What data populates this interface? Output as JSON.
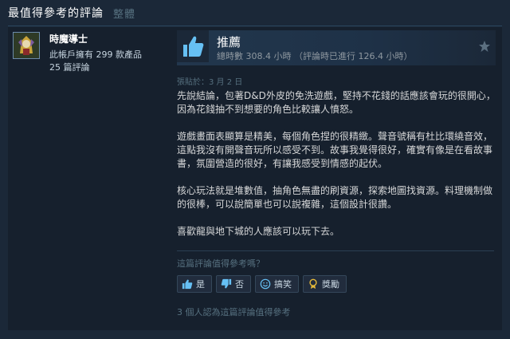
{
  "header": {
    "title": "最值得參考的評論",
    "overall_tab": "整體"
  },
  "author": {
    "name": "時魔導士",
    "products_owned": "此帳戶擁有 299 款產品",
    "reviews_count": "25 篇評論"
  },
  "review": {
    "verdict": "推薦",
    "hours": "總時數 308.4 小時 （評論時已進行 126.4 小時）",
    "posted": "張貼於：3 月 2 日",
    "paragraphs": [
      "先說結論，包著D&D外皮的免洗遊戲，堅持不花錢的話應該會玩的很開心，因為花錢抽不到想要的角色比較讓人憤怒。",
      "遊戲畫面表顯算是精美，每個角色捏的很精緻。聲音號稱有杜比環繞音效，這點我沒有開聲音玩所以感受不到。故事我覺得很好，確實有像是在看故事書，氛圍營造的很好，有讓我感受到情感的起伏。",
      "核心玩法就是堆數值，抽角色無盡的刷資源，探索地圖找資源。料理機制做的很棒，可以說簡單也可以說複雜，這個設計很讚。",
      "喜歡龍與地下城的人應該可以玩下去。"
    ]
  },
  "feedback": {
    "question": "這篇評論值得參考嗎？",
    "yes_label": "是",
    "no_label": "否",
    "funny_label": "搞笑",
    "award_label": "獎勵",
    "helpful_count": "3 個人認為這篇評論值得參考"
  },
  "colors": {
    "accent": "#66c0f4",
    "background": "#1b2838",
    "card": "#16202d"
  },
  "icons": [
    "thumbs-up-icon",
    "star-icon",
    "thumbs-down-icon",
    "smiley-icon",
    "award-icon"
  ]
}
